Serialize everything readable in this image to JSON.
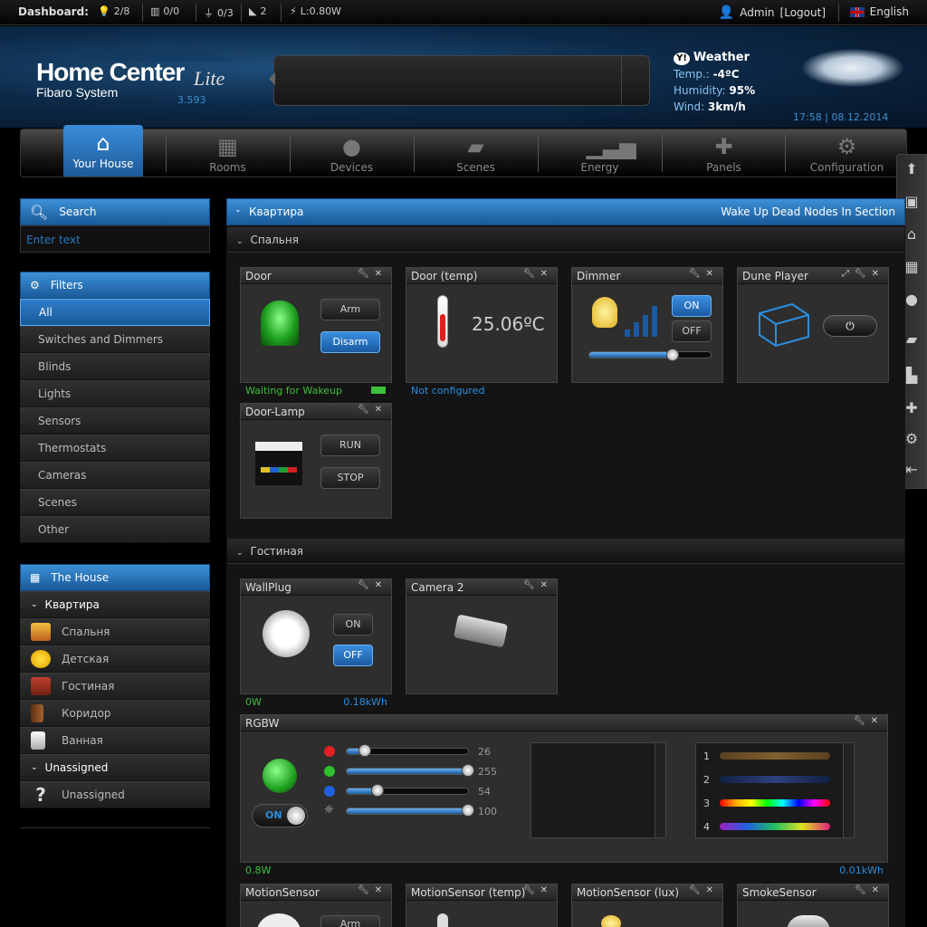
{
  "topbar": {
    "label": "Dashboard:",
    "lights": "2/8",
    "blinds": "0/0",
    "plugs": "0/3",
    "alarms": "2",
    "power": "L:0.80W",
    "user": "Admin",
    "logout": "[Logout]",
    "language": "English"
  },
  "header": {
    "brand": "Home Center",
    "brand_sub": "Fibaro System",
    "edition": "Lite",
    "version": "3.593"
  },
  "weather": {
    "title": "Weather",
    "temp_label": "Temp.:",
    "temp": "-4ºC",
    "humidity_label": "Humidity:",
    "humidity": "95%",
    "wind_label": "Wind:",
    "wind": "3km/h",
    "datetime": "17:58 | 08.12.2014"
  },
  "nav": [
    {
      "label": "Your House"
    },
    {
      "label": "Rooms"
    },
    {
      "label": "Devices"
    },
    {
      "label": "Scenes"
    },
    {
      "label": "Energy"
    },
    {
      "label": "Panels"
    },
    {
      "label": "Configuration"
    }
  ],
  "search": {
    "title": "Search",
    "placeholder": "Enter text"
  },
  "filters": {
    "title": "Filters",
    "items": [
      "All",
      "Switches and Dimmers",
      "Blinds",
      "Lights",
      "Sensors",
      "Thermostats",
      "Cameras",
      "Scenes",
      "Other"
    ]
  },
  "house": {
    "title": "The House",
    "section": "Квартира",
    "rooms": [
      "Спальня",
      "Детская",
      "Гостиная",
      "Коридор",
      "Ванная"
    ],
    "unassigned_section": "Unassigned",
    "unassigned": "Unassigned"
  },
  "main": {
    "title": "Квартира",
    "wake": "Wake Up Dead Nodes In Section",
    "sec1": "Спальня",
    "sec2": "Гостиная"
  },
  "devices": {
    "door": {
      "name": "Door",
      "arm": "Arm",
      "disarm": "Disarm",
      "status": "Waiting for Wakeup"
    },
    "door_temp": {
      "name": "Door (temp)",
      "value": "25.06ºC",
      "status": "Not configured"
    },
    "dimmer": {
      "name": "Dimmer",
      "on": "ON",
      "off": "OFF",
      "level": 0.7
    },
    "dune": {
      "name": "Dune Player"
    },
    "door_lamp": {
      "name": "Door-Lamp",
      "run": "RUN",
      "stop": "STOP"
    },
    "wallplug": {
      "name": "WallPlug",
      "on": "ON",
      "off": "OFF",
      "power": "0W",
      "energy": "0.18kWh"
    },
    "camera": {
      "name": "Camera 2"
    },
    "rgbw": {
      "name": "RGBW",
      "on": "ON",
      "r": "26",
      "g": "255",
      "b": "54",
      "w": "100",
      "power": "0.8W",
      "energy": "0.01kWh",
      "programs": [
        "1",
        "2",
        "3",
        "4"
      ]
    },
    "motion": {
      "name": "MotionSensor",
      "arm": "Arm"
    },
    "motion_temp": {
      "name": "MotionSensor (temp)"
    },
    "motion_lux": {
      "name": "MotionSensor (lux)"
    },
    "smoke": {
      "name": "SmokeSensor"
    }
  },
  "colors": {
    "accent": "#2a7cc8",
    "green": "#3cbf3c",
    "blue_text": "#2a8ee0"
  }
}
